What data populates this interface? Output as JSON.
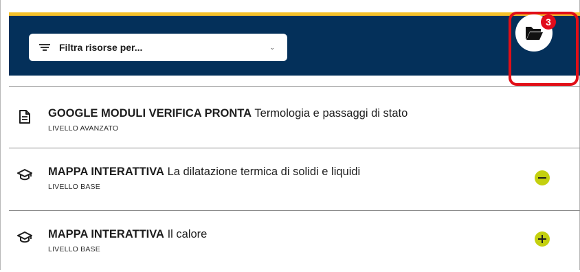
{
  "header": {
    "filter": {
      "label": "Filtra risorse per...",
      "icon": "filter-lines-icon",
      "chevron_icon": "chevron-down-icon"
    },
    "folder_button": {
      "icon": "folder-open-icon",
      "badge_count": "3"
    },
    "colors": {
      "accent_bar": "#f6c12a",
      "header_bg": "#04305a",
      "badge": "#e10b1b",
      "highlight": "#e10e17",
      "toggle": "#c4d00f"
    }
  },
  "resources": [
    {
      "type_icon": "document-icon",
      "category": "GOOGLE MODULI VERIFICA PRONTA",
      "title": "Termologia e passaggi di stato",
      "level": "LIVELLO AVANZATO"
    },
    {
      "type_icon": "graduation-cap-icon",
      "category": "MAPPA INTERATTIVA",
      "title": "La dilatazione termica di solidi e liquidi",
      "level": "LIVELLO BASE",
      "toggle": "minus"
    },
    {
      "type_icon": "graduation-cap-icon",
      "category": "MAPPA INTERATTIVA",
      "title": "Il calore",
      "level": "LIVELLO BASE",
      "toggle": "plus"
    }
  ]
}
